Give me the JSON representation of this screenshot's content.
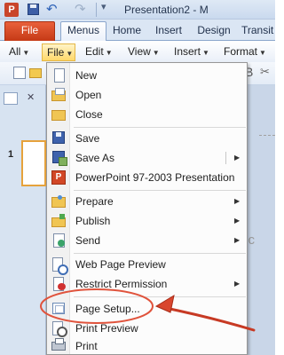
{
  "titlebar": {
    "app_icon": "P",
    "quick_access": [
      "save-icon",
      "undo-icon",
      "redo-icon",
      "customize-icon"
    ],
    "window_title": "Presentation2 - M"
  },
  "ribbon_tabs": {
    "file": "File",
    "menus": "Menus",
    "home": "Home",
    "insert": "Insert",
    "design": "Design",
    "transitions": "Transit"
  },
  "menubar": {
    "all": "All",
    "file": "File",
    "edit": "Edit",
    "view": "View",
    "insert": "Insert",
    "format": "Format"
  },
  "file_menu": {
    "items": [
      {
        "label": "New",
        "icon": "new-document-icon"
      },
      {
        "label": "Open",
        "icon": "open-folder-icon"
      },
      {
        "label": "Close",
        "icon": "close-folder-icon"
      },
      {
        "label": "Save",
        "icon": "save-icon"
      },
      {
        "label": "Save As",
        "icon": "save-as-icon"
      },
      {
        "label": "PowerPoint 97-2003 Presentation",
        "icon": "powerpoint-icon"
      },
      {
        "label": "Prepare",
        "icon": "prepare-icon"
      },
      {
        "label": "Publish",
        "icon": "publish-icon"
      },
      {
        "label": "Send",
        "icon": "send-icon"
      },
      {
        "label": "Web Page Preview",
        "icon": "web-preview-icon"
      },
      {
        "label": "Restrict Permission",
        "icon": "restrict-permission-icon"
      },
      {
        "label": "Page Setup...",
        "icon": "page-setup-icon"
      },
      {
        "label": "Print Preview",
        "icon": "print-preview-icon"
      },
      {
        "label": "Print",
        "icon": "printer-icon"
      }
    ]
  },
  "slides_pane": {
    "slide_number": "1"
  },
  "editor": {
    "placeholder_fragment": "Clic"
  },
  "colors": {
    "file_tab": "#d24726",
    "highlight_border": "#e5b746",
    "annotation": "#e0533c"
  }
}
